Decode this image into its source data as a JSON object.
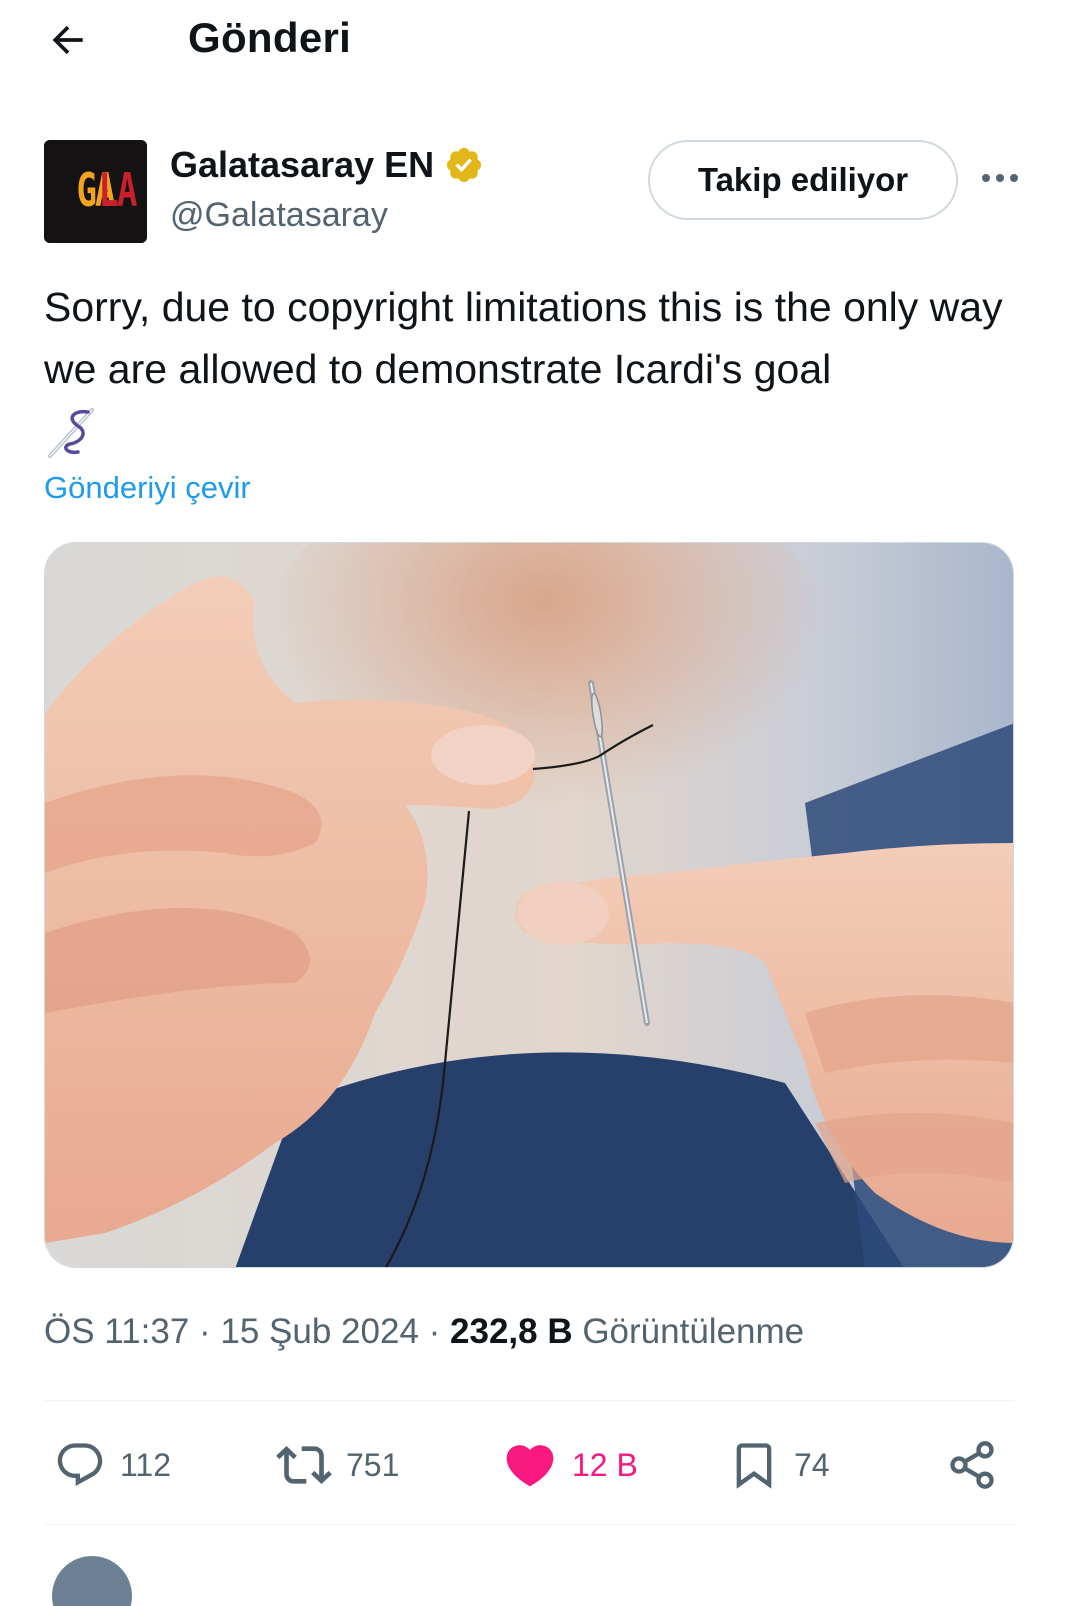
{
  "header": {
    "title": "Gönderi"
  },
  "author": {
    "avatar_text": "GALA",
    "display_name": "Galatasaray EN",
    "handle": "@Galatasaray",
    "follow_label": "Takip ediliyor"
  },
  "tweet": {
    "text": "Sorry, due to copyright limitations this is the only way we are allowed to demonstrate Icardi's goal",
    "emoji": "needle-thread-icon",
    "translate_label": "Gönderiyi çevir",
    "media_alt": "Hands threading a needle"
  },
  "meta": {
    "time": "ÖS 11:37",
    "sep1": " · ",
    "date": "15 Şub 2024",
    "sep2": " · ",
    "views_count": "232,8 B",
    "views_label": " Görüntülenme"
  },
  "actions": {
    "reply_count": "112",
    "retweet_count": "751",
    "like_count": "12 B",
    "bookmark_count": "74"
  },
  "colors": {
    "accent": "#1d9bf0",
    "like": "#f91880",
    "secondary_text": "#536471",
    "verified_gold": "#e2b719"
  }
}
